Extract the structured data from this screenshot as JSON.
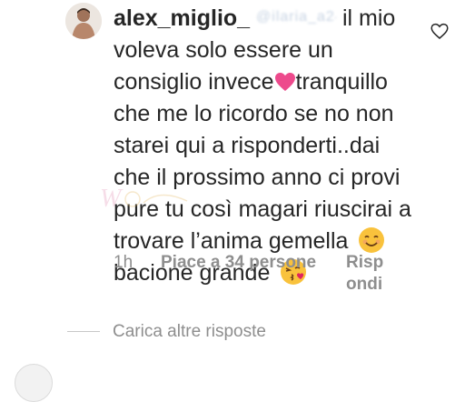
{
  "comment": {
    "username": "alex_miglio_",
    "mention": "@ilaria_a24",
    "text_part1": " il mio voleva solo essere un consiglio invece",
    "heart_emoji": "pink-heart",
    "text_part2": "tranquillo che me lo ricordo se no non starei qui a risponderti..dai che il prossimo anno ci provi pure tu così magari riuscirai a trovare l’anima gemella",
    "smile_emoji": "smiling-face",
    "text_part3": "bacione grande",
    "kiss_emoji": "face-blowing-kiss"
  },
  "meta": {
    "time": "1h",
    "likes": "Piace a 34 persone",
    "reply": "Rispondi"
  },
  "replies": {
    "load_more": "Carica altre risposte"
  },
  "colors": {
    "text": "#262626",
    "muted": "#8e8e8e",
    "heart": "#ed4a8c",
    "emoji": "#f9c23c"
  }
}
